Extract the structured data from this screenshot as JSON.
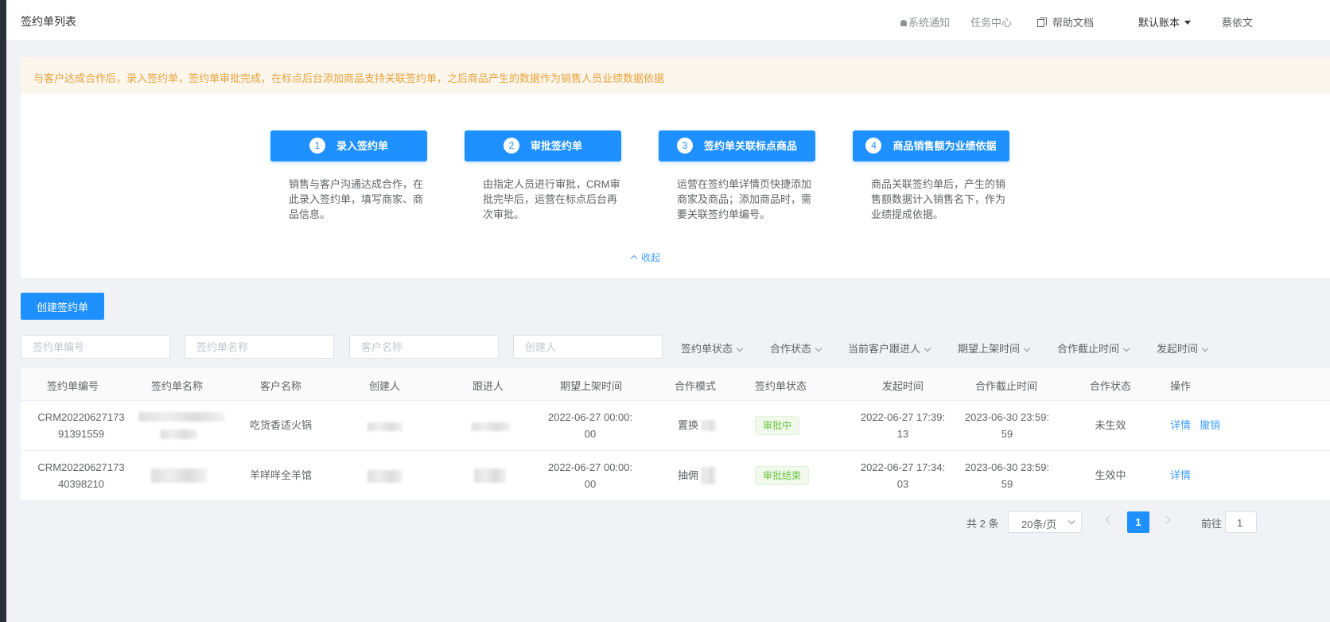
{
  "header": {
    "title": "签约单列表",
    "notifications": "系统通知",
    "task_center": "任务中心",
    "help_docs": "帮助文档",
    "account": "默认账本",
    "user": "蔡依文"
  },
  "notice": "与客户达成合作后，录入签约单，签约单审批完成，在标点后台添加商品支持关联签约单，之后商品产生的数据作为销售人员业绩数据依据",
  "steps": [
    {
      "num": "1",
      "title": "录入签约单",
      "desc": "销售与客户沟通达成合作，在此录入签约单，填写商家、商品信息。"
    },
    {
      "num": "2",
      "title": "审批签约单",
      "desc": "由指定人员进行审批，CRM审批完毕后，运营在标点后台再次审批。"
    },
    {
      "num": "3",
      "title": "签约单关联标点商品",
      "desc": "运营在签约单详情页快捷添加商家及商品；添加商品时，需要关联签约单编号。"
    },
    {
      "num": "4",
      "title": "商品销售额为业绩依据",
      "desc": "商品关联签约单后，产生的销售额数据计入销售名下，作为业绩提成依据。"
    }
  ],
  "collapse_label": "收起",
  "create_button": "创建签约单",
  "filters": {
    "inputs": [
      "签约单编号",
      "签约单名称",
      "客户名称",
      "创建人"
    ],
    "dropdowns": [
      "签约单状态",
      "合作状态",
      "当前客户跟进人",
      "期望上架时间",
      "合作截止时间",
      "发起时间"
    ]
  },
  "table": {
    "columns": [
      "签约单编号",
      "签约单名称",
      "客户名称",
      "创建人",
      "跟进人",
      "期望上架时间",
      "合作模式",
      "签约单状态",
      "发起时间",
      "合作截止时间",
      "合作状态",
      "操作"
    ],
    "rows": [
      {
        "id_l1": "CRM20220627173",
        "id_l2": "91391559",
        "customer": "吃货香适火锅",
        "expected_l1": "2022-06-27 00:00:",
        "expected_l2": "00",
        "mode": "置换",
        "status": "审批中",
        "start_l1": "2022-06-27 17:39:",
        "start_l2": "13",
        "deadline_l1": "2023-06-30 23:59:",
        "deadline_l2": "59",
        "coop_status": "未生效",
        "actions": [
          "详情",
          "撤销"
        ]
      },
      {
        "id_l1": "CRM20220627173",
        "id_l2": "40398210",
        "customer": "羊咩咩全羊馆",
        "expected_l1": "2022-06-27 00:00:",
        "expected_l2": "00",
        "mode": "抽佣",
        "status": "审批结束",
        "start_l1": "2022-06-27 17:34:",
        "start_l2": "03",
        "deadline_l1": "2023-06-30 23:59:",
        "deadline_l2": "59",
        "coop_status": "生效中",
        "actions": [
          "详情"
        ]
      }
    ]
  },
  "pagination": {
    "total": "共 2 条",
    "page_size": "20条/页",
    "current": "1",
    "goto_label": "前往",
    "goto_value": "1"
  },
  "colors": {
    "primary": "#1e90ff",
    "warning_text": "#e6a23c",
    "warning_bg": "#fdf6ec",
    "success": "#67c23a",
    "link": "#409eff"
  }
}
